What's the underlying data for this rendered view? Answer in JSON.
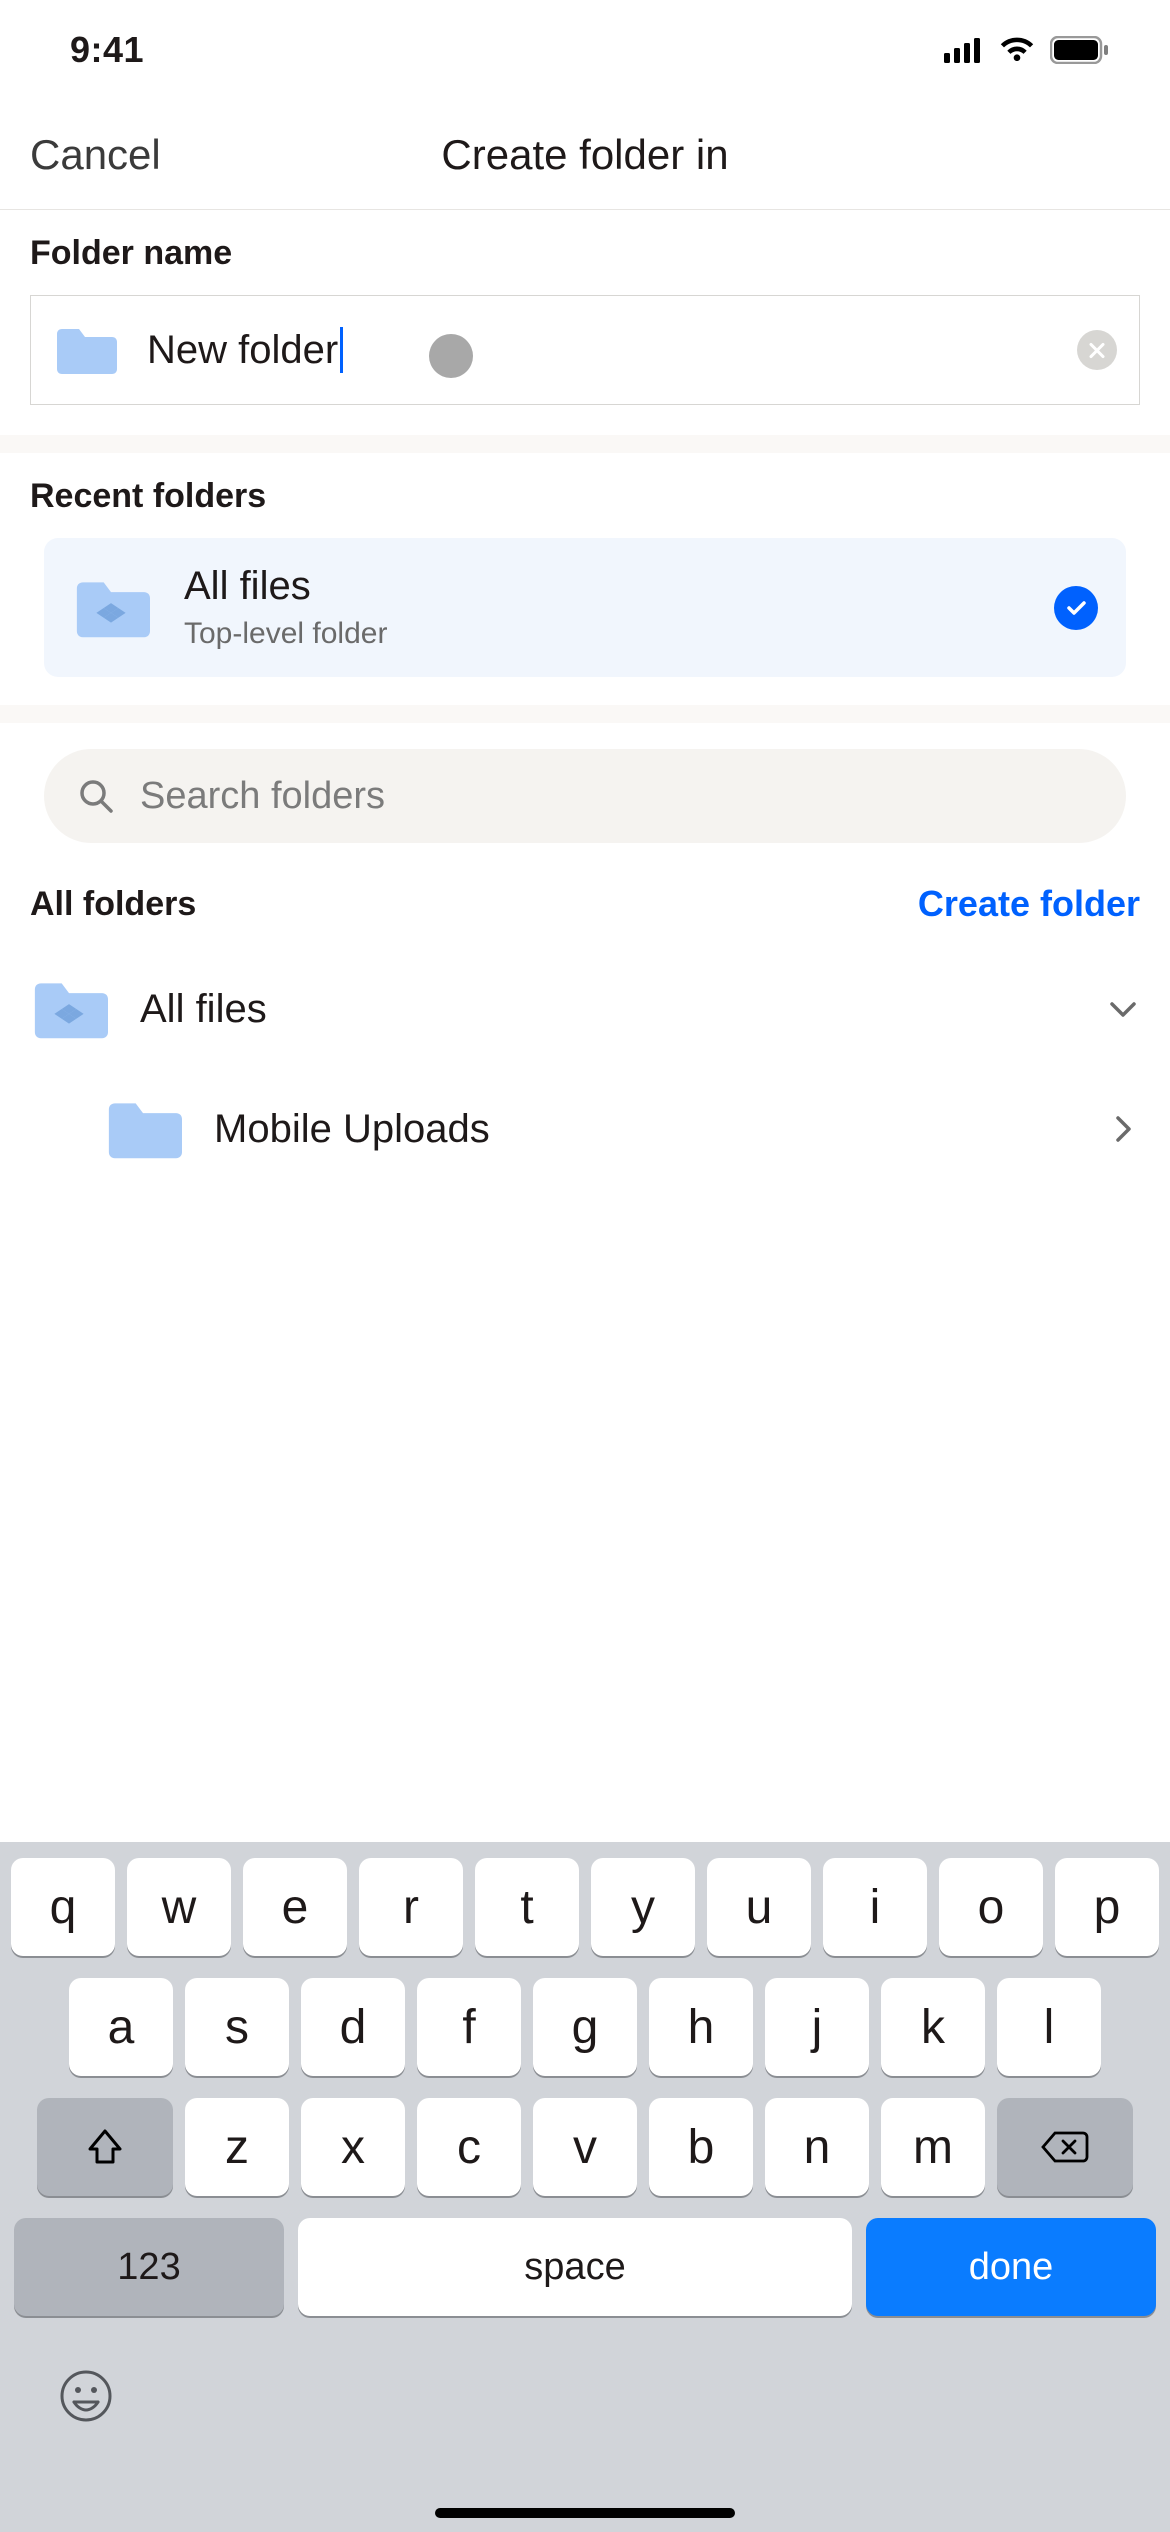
{
  "status": {
    "time": "9:41"
  },
  "nav": {
    "cancel": "Cancel",
    "title": "Create folder in"
  },
  "folder_name": {
    "label": "Folder name",
    "value": "New folder"
  },
  "recent": {
    "label": "Recent folders",
    "item": {
      "title": "All files",
      "subtitle": "Top-level folder"
    }
  },
  "search": {
    "placeholder": "Search folders"
  },
  "all_folders": {
    "label": "All folders",
    "create": "Create folder",
    "items": [
      {
        "name": "All files"
      },
      {
        "name": "Mobile Uploads"
      }
    ]
  },
  "keyboard": {
    "row1": [
      "q",
      "w",
      "e",
      "r",
      "t",
      "y",
      "u",
      "i",
      "o",
      "p"
    ],
    "row2": [
      "a",
      "s",
      "d",
      "f",
      "g",
      "h",
      "j",
      "k",
      "l"
    ],
    "row3": [
      "z",
      "x",
      "c",
      "v",
      "b",
      "n",
      "m"
    ],
    "nums": "123",
    "space": "space",
    "done": "done"
  }
}
